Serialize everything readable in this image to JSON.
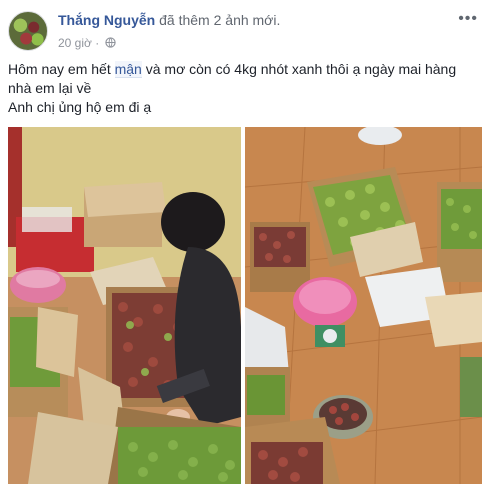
{
  "post": {
    "author": "Thắng Nguyễn",
    "action": "đã thêm 2 ảnh mới.",
    "time": "20 giờ",
    "separator": "·",
    "privacy_icon": "globe-icon",
    "more_icon": "more-options-icon",
    "text_line_1_before": "Hôm nay em hết ",
    "text_mention": "mận",
    "text_line_1_after": " và mơ còn có 4kg nhót xanh thôi ạ ngày mai hàng nhà em lại về",
    "text_line_2": "Anh chị ủng hộ em đi ạ"
  },
  "colors": {
    "author": "#365899",
    "meta": "#90949c",
    "text": "#1d2129",
    "floor": "#c8874f"
  }
}
